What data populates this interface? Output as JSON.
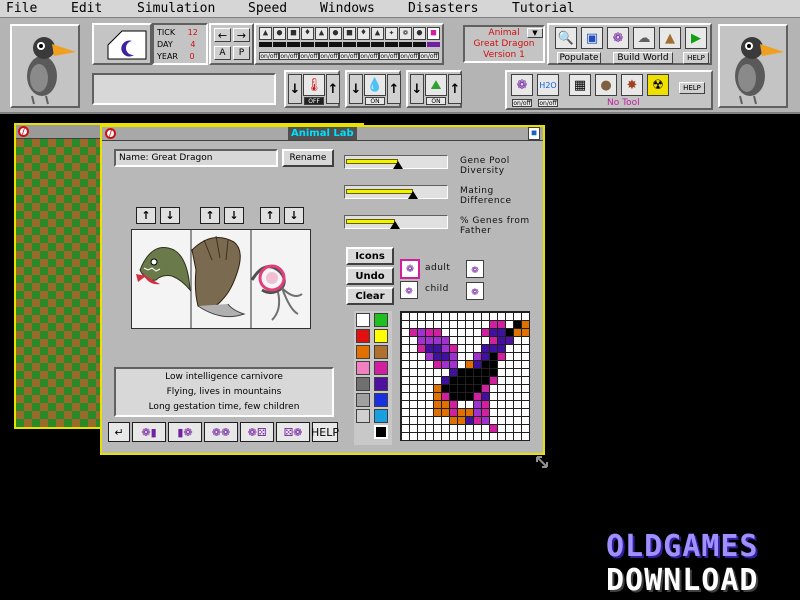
{
  "menu": [
    "File",
    "Edit",
    "Simulation",
    "Speed",
    "Windows",
    "Disasters",
    "Tutorial"
  ],
  "status": {
    "tick_label": "TICK",
    "tick_value": "12",
    "day_label": "DAY",
    "day_value": "4",
    "year_label": "YEAR",
    "year_value": "0"
  },
  "toolbar": {
    "btn_a": "A",
    "btn_p": "P",
    "onoff": "on/off",
    "current_animal": [
      "Animal",
      "Great Dragon",
      "Version 1"
    ],
    "populate_label": "Populate",
    "build_world_label": "Build World",
    "help_label": "HELP",
    "off_label": "OFF",
    "on_label": "ON",
    "h2o_label": "H2O",
    "no_tool_label": "No Tool"
  },
  "animal_lab": {
    "title": "Animal Lab",
    "name_field": "Name: Great Dragon",
    "rename_label": "Rename",
    "sliders": [
      {
        "label1": "Gene Pool",
        "label2": "Diversity",
        "level": 0.52
      },
      {
        "label1": "Mating",
        "label2": "Difference",
        "level": 0.67
      },
      {
        "label1": "% Genes from",
        "label2": "Father",
        "level": 0.49
      }
    ],
    "icons_label": "Icons",
    "undo_label": "Undo",
    "clear_label": "Clear",
    "adult_label": "adult",
    "child_label": "child",
    "description": [
      "Low intelligence carnivore",
      "Flying, lives in mountains",
      "Long gestation time, few children"
    ],
    "help_label": "HELP"
  },
  "palette": [
    "#ffffff",
    "#20c020",
    "#e01010",
    "#ffff00",
    "#e07000",
    "#b07030",
    "#f080c0",
    "#d020a0",
    "#707070",
    "#5010a0",
    "#a0a0a0",
    "#1830e0",
    "#d0d0d0",
    "#18a0e0",
    "#000000"
  ],
  "watermark": {
    "line1": "OLDGAMES",
    "line2": "DOWNLOAD"
  },
  "colors": {
    "accent_red": "#d01010",
    "title_cyan": "#00e0ff",
    "window_yellow": "#e8e000",
    "grass": "#2a8a2a",
    "dirt": "#9a6a2a"
  }
}
